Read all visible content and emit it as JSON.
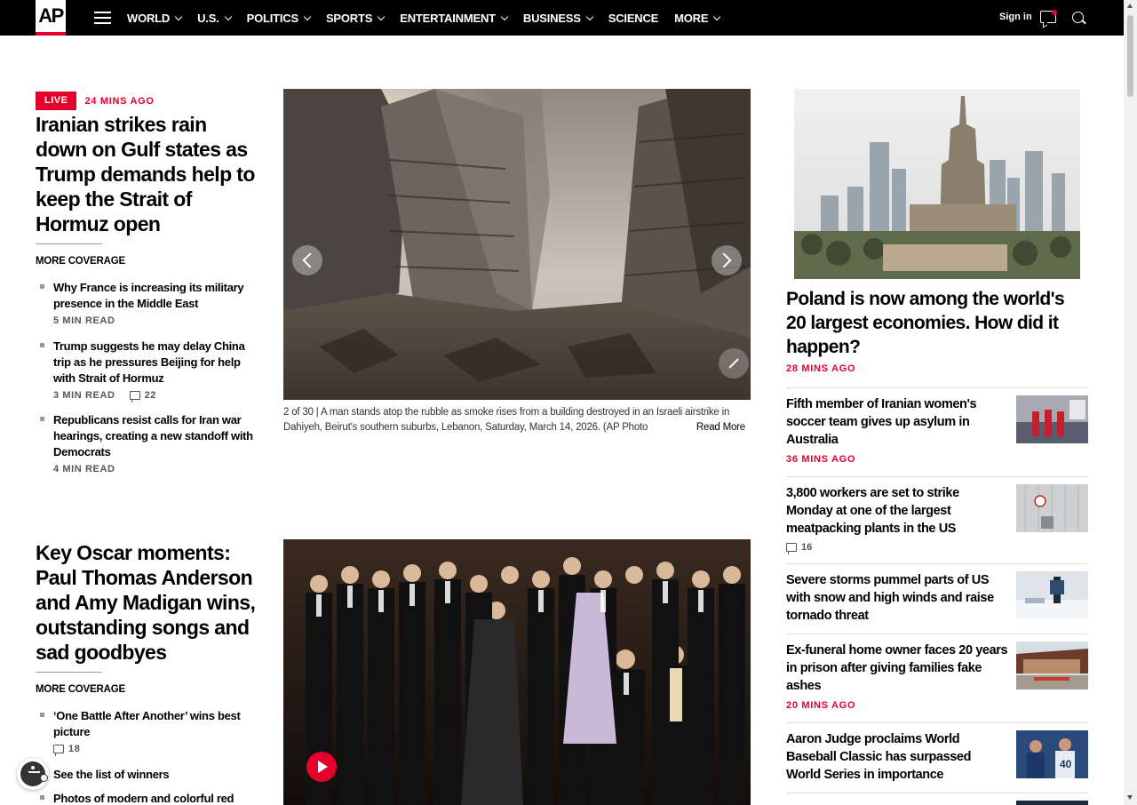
{
  "nav": {
    "logo": "AP",
    "items": [
      {
        "label": "WORLD",
        "has_menu": true
      },
      {
        "label": "U.S.",
        "has_menu": true
      },
      {
        "label": "POLITICS",
        "has_menu": true
      },
      {
        "label": "SPORTS",
        "has_menu": true
      },
      {
        "label": "ENTERTAINMENT",
        "has_menu": true
      },
      {
        "label": "BUSINESS",
        "has_menu": true
      },
      {
        "label": "SCIENCE",
        "has_menu": false
      },
      {
        "label": "MORE",
        "has_menu": true
      }
    ],
    "sign_in": "Sign in"
  },
  "lead": {
    "live_label": "LIVE",
    "time": "24 MINS AGO",
    "headline": "Iranian strikes rain down on Gulf states as Trump demands help to keep the Strait of Hormuz open",
    "more_coverage": "MORE COVERAGE",
    "coverage": [
      {
        "title": "Why France is increasing its military presence in the Middle East",
        "meta": "5 MIN READ",
        "comments": ""
      },
      {
        "title": "Trump suggests he may delay China trip as he pressures Beijing for help with Strait of Hormuz",
        "meta": "3 MIN READ",
        "comments": "22"
      },
      {
        "title": "Republicans resist calls for Iran war hearings, creating a new standoff with Democrats",
        "meta": "4 MIN READ",
        "comments": ""
      }
    ],
    "gallery": {
      "counter": "2 of 30 |",
      "caption": "A man stands atop the rubble as smoke rises from a building destroyed in an Israeli airstrike in Dahiyeh, Beirut's southern suburbs, Lebanon, Saturday, March 14, 2026. (AP Photo",
      "read_more": "Read More"
    }
  },
  "oscar": {
    "headline": "Key Oscar moments: Paul Thomas Anderson and Amy Madigan wins, outstanding songs and sad goodbyes",
    "more_coverage": "MORE COVERAGE",
    "coverage": [
      {
        "title": "‘One Battle After Another’ wins best picture",
        "comments": "18"
      },
      {
        "title": "See the list of winners",
        "comments": ""
      },
      {
        "title": "Photos of modern and colorful red",
        "comments": ""
      }
    ]
  },
  "right": {
    "feature": {
      "headline": "Poland is now among the world's 20 largest economies. How did it happen?",
      "time": "28 MINS AGO"
    },
    "items": [
      {
        "title": "Fifth member of Iranian women's soccer team gives up asylum in Australia",
        "time": "36 MINS AGO",
        "comments": ""
      },
      {
        "title": "3,800 workers are set to strike Monday at one of the largest meatpacking plants in the US",
        "time": "",
        "comments": "16"
      },
      {
        "title": "Severe storms pummel parts of US with snow and high winds and raise tornado threat",
        "time": "",
        "comments": ""
      },
      {
        "title": "Ex-funeral home owner faces 20 years in prison after giving families fake ashes",
        "time": "20 MINS AGO",
        "comments": ""
      },
      {
        "title": "Aaron Judge proclaims World Baseball Classic has surpassed World Series in importance",
        "time": "",
        "comments": ""
      }
    ]
  },
  "colors": {
    "brand_red": "#e4002b",
    "nav_bg": "#000000"
  }
}
